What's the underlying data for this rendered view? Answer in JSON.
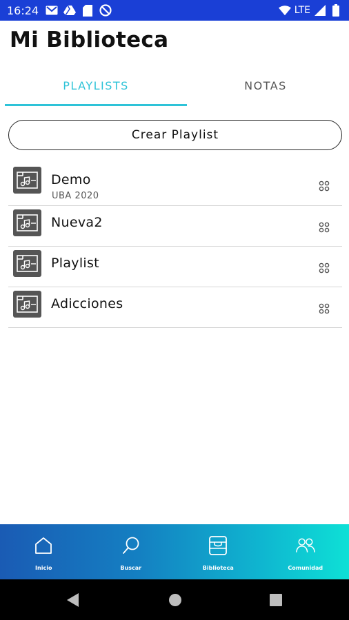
{
  "status_bar": {
    "time": "16:24",
    "network": "LTE",
    "icons_left": [
      "gmail-icon",
      "drive-icon",
      "sd-card-icon",
      "blocked-icon"
    ],
    "icons_right": [
      "wifi-icon",
      "signal-icon",
      "battery-icon"
    ]
  },
  "header": {
    "title": "Mi Biblioteca"
  },
  "tabs": [
    {
      "label": "PLAYLISTS",
      "active": true
    },
    {
      "label": "NOTAS",
      "active": false
    }
  ],
  "colors": {
    "accent": "#2ec3d8",
    "status_bar": "#1a3fd6",
    "icon_bg": "#555555"
  },
  "create_button": {
    "label": "Crear Playlist"
  },
  "playlists": [
    {
      "name": "Demo",
      "subtitle": "UBA 2020",
      "icon": "music-folder-icon"
    },
    {
      "name": "Nueva2",
      "subtitle": "",
      "icon": "music-folder-icon"
    },
    {
      "name": "Playlist",
      "subtitle": "",
      "icon": "music-folder-icon"
    },
    {
      "name": "Adicciones",
      "subtitle": "",
      "icon": "music-folder-icon"
    }
  ],
  "bottom_nav": [
    {
      "label": "Inicio",
      "icon": "home-icon"
    },
    {
      "label": "Buscar",
      "icon": "search-icon"
    },
    {
      "label": "Biblioteca",
      "icon": "library-icon"
    },
    {
      "label": "Comunidad",
      "icon": "community-icon"
    }
  ],
  "system_nav": [
    "back-icon",
    "home-circle-icon",
    "recents-icon"
  ]
}
